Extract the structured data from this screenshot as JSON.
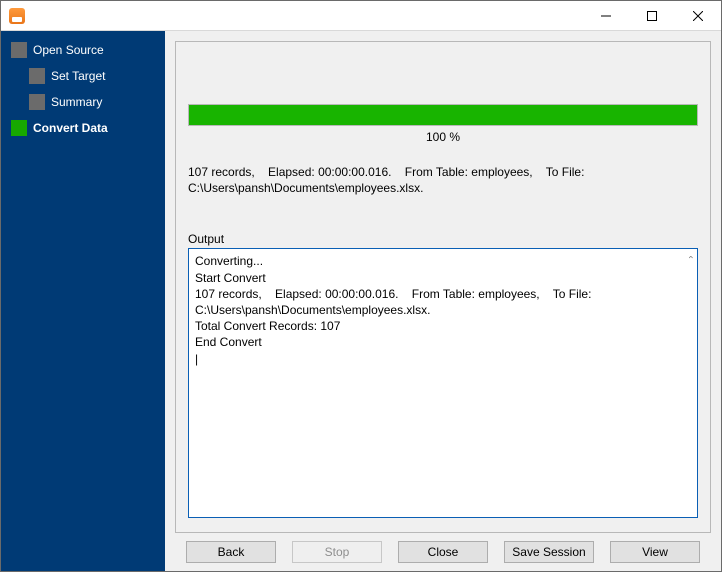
{
  "sidebar": {
    "items": [
      {
        "label": "Open Source",
        "indent": false,
        "active": false
      },
      {
        "label": "Set Target",
        "indent": true,
        "active": false
      },
      {
        "label": "Summary",
        "indent": true,
        "active": false
      },
      {
        "label": "Convert Data",
        "indent": false,
        "active": true
      }
    ]
  },
  "progress": {
    "percent_text": "100 %",
    "percent_value": 100
  },
  "status_text": "107 records,    Elapsed: 00:00:00.016.    From Table: employees,    To File: C:\\Users\\pansh\\Documents\\employees.xlsx.",
  "output": {
    "label": "Output",
    "text": "Converting...\nStart Convert\n107 records,    Elapsed: 00:00:00.016.    From Table: employees,    To File: C:\\Users\\pansh\\Documents\\employees.xlsx.\nTotal Convert Records: 107\nEnd Convert\n|"
  },
  "buttons": {
    "back": "Back",
    "stop": "Stop",
    "close": "Close",
    "save": "Save Session",
    "view": "View"
  }
}
